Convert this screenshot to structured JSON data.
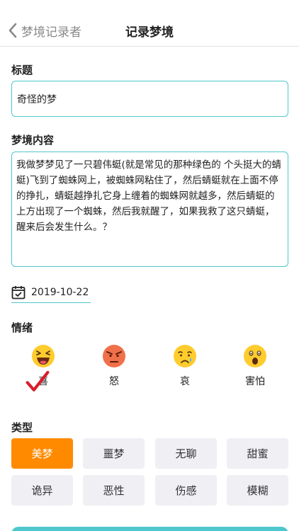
{
  "nav": {
    "back_label": "梦境记录者",
    "title": "记录梦境"
  },
  "title_section": {
    "label": "标题",
    "value": "奇怪的梦"
  },
  "content_section": {
    "label": "梦境内容",
    "value": "我做梦梦见了一只碧伟蜓(就是常见的那种绿色的 个头挺大的蜻蜓)飞到了蜘蛛网上，被蜘蛛网粘住了，然后蜻蜓就在上面不停的挣扎，蜻蜓越挣扎它身上缠着的蜘蛛网就越多，然后蜻蜓的上方出现了一个蜘蛛，然后我就醒了，如果我救了这只蜻蜓，醒来后会发生什么。？"
  },
  "date": {
    "value": "2019-10-22",
    "icon": "calendar-check-icon"
  },
  "emotion_section": {
    "label": "情绪",
    "items": [
      {
        "label": "喜",
        "icon": "laughing-face-icon",
        "selected": true
      },
      {
        "label": "怒",
        "icon": "angry-face-icon",
        "selected": false
      },
      {
        "label": "哀",
        "icon": "sad-face-icon",
        "selected": false
      },
      {
        "label": "害怕",
        "icon": "scared-face-icon",
        "selected": false
      }
    ]
  },
  "type_section": {
    "label": "类型",
    "items": [
      {
        "label": "美梦",
        "selected": true
      },
      {
        "label": "噩梦",
        "selected": false
      },
      {
        "label": "无聊",
        "selected": false
      },
      {
        "label": "甜蜜",
        "selected": false
      },
      {
        "label": "诡异",
        "selected": false
      },
      {
        "label": "恶性",
        "selected": false
      },
      {
        "label": "伤感",
        "selected": false
      },
      {
        "label": "模糊",
        "selected": false
      }
    ]
  },
  "colors": {
    "accent": "#4fc7cc",
    "selected_type": "#ff8a00",
    "unselected_type": "#efeff4",
    "check_mark": "#d81e2b"
  }
}
